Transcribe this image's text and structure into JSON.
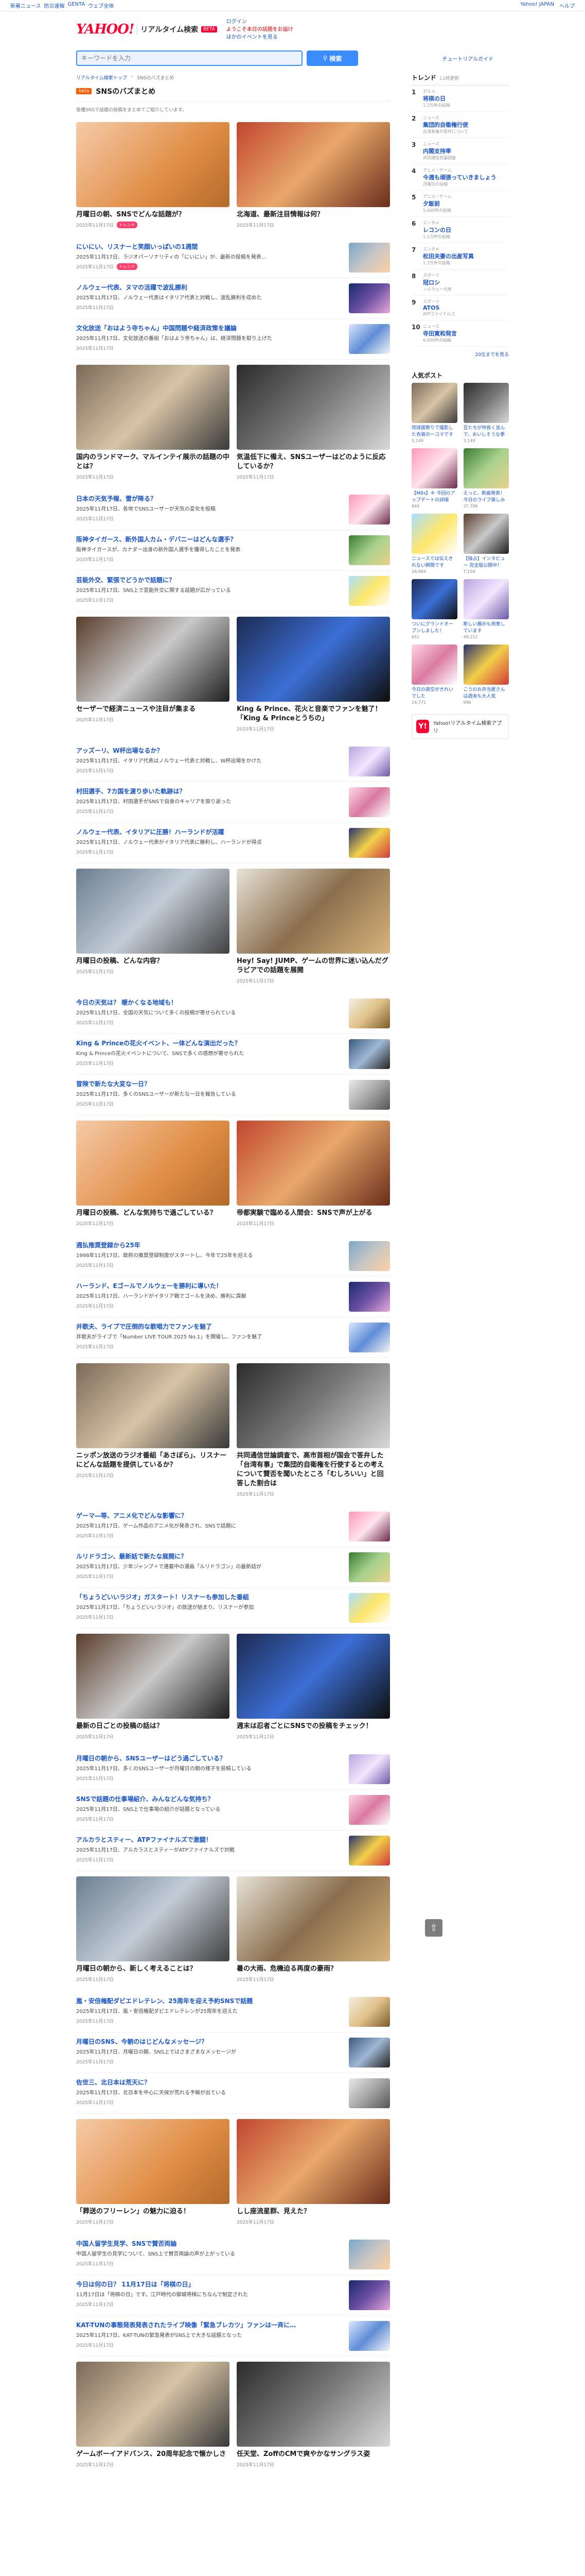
{
  "util": {
    "left": [
      "新着ニュース",
      "防災速報",
      "GENTA",
      "ウェブ全体"
    ],
    "right": [
      "Yahoo! JAPAN",
      "ヘルプ"
    ]
  },
  "header": {
    "logo": "YAHOO!",
    "logo_sub": "JAPAN",
    "service": "リアルタイム検索",
    "beta": "BETA",
    "links": [
      "ログイン",
      "ようこそ本日の話題をお届け",
      "ほかのイベントを見る"
    ]
  },
  "search": {
    "placeholder": "キーワードを入力",
    "button": "検索",
    "tutorial": "チュートリアルガイド"
  },
  "crumb": [
    "リアルタイム検索トップ",
    "SNSのバズまとめ"
  ],
  "page": {
    "badge": "beta",
    "title": "SNSのバズまとめ",
    "description": "各種SNSで話題の投稿をまとめてご紹介しています。"
  },
  "pairs": [
    [
      {
        "title": "月曜日の朝、SNSでどんな話題が？",
        "meta": "2025年11月17日",
        "tag": "トレンド"
      },
      {
        "title": "北海道、最新注目情報は何？",
        "meta": "2025年11月17日",
        "tag": ""
      }
    ],
    [
      {
        "title": "国内のランドマーク、マルインテイ展示の話題の中とは？",
        "meta": "2025年11月17日",
        "tag": ""
      },
      {
        "title": "気温低下に備え、SNSユーザーはどのように反応しているか？",
        "meta": "2025年11月17日",
        "tag": ""
      }
    ],
    [
      {
        "title": "セーザーで経済ニュースや注目が集まる",
        "meta": "2025年11月17日",
        "tag": ""
      },
      {
        "title": "King & Prince、花火と音楽でファンを魅了！「King & Princeとうちの」",
        "meta": "2025年11月17日",
        "tag": ""
      }
    ],
    [
      {
        "title": "月曜日の投稿、どんな内容？",
        "meta": "2025年11月17日",
        "tag": ""
      },
      {
        "title": "Hey! Say! JUMP、ゲームの世界に迷い込んだグラビアでの話題を展開",
        "meta": "2025年11月17日",
        "tag": ""
      }
    ],
    [
      {
        "title": "月曜日の投稿、どんな気持ちで過ごしている？",
        "meta": "2025年11月17日",
        "tag": ""
      },
      {
        "title": "帝都実験で臨める人間会：SNSで声が上がる",
        "meta": "2025年11月17日",
        "tag": ""
      }
    ],
    [
      {
        "title": "ニッポン放送のラジオ番組「あさぼら」、リスナーにどんな話題を提供しているか？",
        "meta": "2025年11月17日",
        "tag": ""
      },
      {
        "title": "共同通信世論調査で、高市首相が国会で答弁した「台湾有事」で集団的自衛権を行使するとの考えについて賛否を聞いたところ「むしろいい」と回答した割合は",
        "meta": "2025年11月17日",
        "tag": ""
      }
    ],
    [
      {
        "title": "最新の日ごとの投稿の話は？",
        "meta": "2025年11月17日",
        "tag": ""
      },
      {
        "title": "週末は忍者ごとにSNSでの投稿をチェック！",
        "meta": "2025年11月17日",
        "tag": ""
      }
    ],
    [
      {
        "title": "月曜日の朝から、新しく考えることは？",
        "meta": "2025年11月17日",
        "tag": ""
      },
      {
        "title": "暑の大雨、危機迫る再度の豪雨？",
        "meta": "2025年11月17日",
        "tag": ""
      }
    ],
    [
      {
        "title": "「葬送のフリーレン」の魅力に迫る！",
        "meta": "2025年11月17日",
        "tag": ""
      },
      {
        "title": "しし座流星群、見えた？",
        "meta": "2025年11月17日",
        "tag": ""
      }
    ],
    [
      {
        "title": "ゲームボーイアドバンス、20周年記念で懐かしさ",
        "meta": "2025年11月17日",
        "tag": ""
      },
      {
        "title": "任天堂、ZoffのCMで爽やかなサングラス姿",
        "meta": "2025年11月17日",
        "tag": ""
      }
    ]
  ],
  "lists": [
    [
      {
        "title": "にいにい、リスナーと笑顔いっぱいの1週間",
        "excerpt": "2025年11月17日、ラジオパーソナリティの「にいにい」が、最新の投稿を発表...",
        "meta": "2025年11月17日",
        "tag": "トレンド"
      },
      {
        "title": "ノルウェー代表、ヌマの活躍で波乱勝利",
        "excerpt": "2025年11月17日、ノルウェー代表はイタリア代表と対戦し、波乱勝利を収めた",
        "meta": "2025年11月17日",
        "tag": ""
      },
      {
        "title": "文化放送「おはよう寺ちゃん」中国問題や経済政策を議論",
        "excerpt": "2025年11月17日、文化放送の番組「おはよう寺ちゃん」は、経済問題を取り上げた",
        "meta": "2025年11月17日",
        "tag": ""
      }
    ],
    [
      {
        "title": "日本の天気予報、雪が降る？",
        "excerpt": "2025年11月17日、各地でSNSユーザーが天気の変化を投稿",
        "meta": "2025年11月17日",
        "tag": ""
      },
      {
        "title": "阪神タイガース、新外国人カム・デバニーはどんな選手？",
        "excerpt": "阪神タイガースが、カナダー出身の新外国人選手を獲得したことを発表",
        "meta": "2025年11月17日",
        "tag": ""
      },
      {
        "title": "芸能外交、緊張でどうかで話題に？",
        "excerpt": "2025年11月17日、SNS上で芸能外交に関する話題が広がっている",
        "meta": "2025年11月17日",
        "tag": ""
      }
    ],
    [
      {
        "title": "アッズーリ、W杯出場なるか？",
        "excerpt": "2025年11月17日、イタリア代表はノルウェー代表と対戦し、W杯出場をかけた",
        "meta": "2025年11月17日",
        "tag": ""
      },
      {
        "title": "村田選手、7カ国を渡り歩いた軌跡は？",
        "excerpt": "2025年11月17日、村田選手がSNSで自身のキャリアを振り返った",
        "meta": "2025年11月17日",
        "tag": ""
      },
      {
        "title": "ノルウェー代表、イタリアに圧勝！ハーランドが活躍",
        "excerpt": "2025年11月17日、ノルウェー代表がイタリア代表に勝利し、ハーランドが得点",
        "meta": "2025年11月17日",
        "tag": ""
      }
    ],
    [
      {
        "title": "今日の天気は？ 暖かくなる地域も！",
        "excerpt": "2025年11月17日、全国の天気について多くの投稿が寄せられている",
        "meta": "2025年11月17日",
        "tag": ""
      },
      {
        "title": "King & Princeの花火イベント、一体どんな演出だった？",
        "excerpt": "King & Princeの花火イベントについて、SNSで多くの感想が寄せられた",
        "meta": "2025年11月17日",
        "tag": ""
      },
      {
        "title": "冒険で新たな大変な一日？",
        "excerpt": "2025年11月17日、多くのSNSユーザーが新たな一日を報告している",
        "meta": "2025年11月17日",
        "tag": ""
      }
    ],
    [
      {
        "title": "週払推奨登録から25年",
        "excerpt": "1998年11月17日、政府の推奨登録制度がスタートし、今年で25年を迎える",
        "meta": "2025年11月17日",
        "tag": ""
      },
      {
        "title": "ハーランド、Eゴールでノルウェーを勝利に導いた！",
        "excerpt": "2025年11月17日、ハーランドがイタリア戦でゴールを決め、勝利に貢献",
        "meta": "2025年11月17日",
        "tag": ""
      },
      {
        "title": "井歌夫、ライブで圧倒的な歌唱力でファンを魅了",
        "excerpt": "井歌夫がライブで「Number LIVE TOUR 2025 No.1」を開催し、ファンを魅了",
        "meta": "2025年11月17日",
        "tag": ""
      }
    ],
    [
      {
        "title": "ゲーマ―等、アニメ化でどんな影響に？",
        "excerpt": "2025年11月17日、ゲーム作品のアニメ化が発表され、SNSで話題に",
        "meta": "2025年11月17日",
        "tag": ""
      },
      {
        "title": "ルリドラゴン、最新話で新たな展開に？",
        "excerpt": "2025年11月17日、少年ジャンプ＋で連載中の漫画「ルリドラゴン」の最新話が",
        "meta": "2025年11月17日",
        "tag": ""
      },
      {
        "title": "「ちょうどいいラジオ」ガスタート！リスナーも参加した番組",
        "excerpt": "2025年11月17日、「ちょうどいいラジオ」の放送が始まり、リスナーが参加",
        "meta": "2025年11月17日",
        "tag": ""
      }
    ],
    [
      {
        "title": "月曜日の朝から、SNSユーザーはどう過ごしている？",
        "excerpt": "2025年11月17日、多くのSNSユーザーが月曜日の朝の様子を投稿している",
        "meta": "2025年11月17日",
        "tag": ""
      },
      {
        "title": "SNSで話題の仕事場紹介、みんなどんな気持ち？",
        "excerpt": "2025年11月17日、SNS上で仕事場の紹介が話題となっている",
        "meta": "2025年11月17日",
        "tag": ""
      },
      {
        "title": "アルカラとスティー、ATPファイナルズで激闘！",
        "excerpt": "2025年11月17日、アルカラスとスティーがATPファイナルズで対戦",
        "meta": "2025年11月17日",
        "tag": ""
      }
    ],
    [
      {
        "title": "嵐・安倍権配ダビエドレテレン、25周年を迎え予約SNSで話題",
        "excerpt": "2025年11月17日、嵐・安倍権配ダビエドレテレンが25周年を迎えた",
        "meta": "2025年11月17日",
        "tag": ""
      },
      {
        "title": "月曜日のSNS、今朝のはじどんなメッセージ？",
        "excerpt": "2025年11月17日、月曜日の朝、SNS上ではさまざまなメッセージが",
        "meta": "2025年11月17日",
        "tag": ""
      },
      {
        "title": "佐世三、北日本は荒天に？",
        "excerpt": "2025年11月17日、北日本を中心に天候が荒れる予報が出ている",
        "meta": "2025年11月17日",
        "tag": ""
      }
    ],
    [
      {
        "title": "中国人留学生見学、SNSで賛否両論",
        "excerpt": "中国人留学生の見学について、SNS上で賛否両論の声が上がっている",
        "meta": "2025年11月17日",
        "tag": ""
      },
      {
        "title": "今日は何の日？ 11月17日は「将棋の日」",
        "excerpt": "11月17日は「将棋の日」です。江戸時代の御城将棋にちなんで制定された",
        "meta": "2025年11月17日",
        "tag": ""
      },
      {
        "title": "KAT-TUNの事態発表発表されたライブ映像「緊急ブレカツ」ファンは一斉に…",
        "excerpt": "2025年11月17日、KAT-TUNの緊急発表がSNS上で大きな話題となった",
        "meta": "2025年11月17日",
        "tag": ""
      }
    ]
  ],
  "sidebar": {
    "trend_title": "トレンド",
    "trend_updated": "11時更新",
    "trends": [
      {
        "rank": "1",
        "category": "グルメ",
        "keyword": "将棋の日",
        "sub": "1.2万件の投稿"
      },
      {
        "rank": "2",
        "category": "ニュース",
        "keyword": "集団的自衛権行使",
        "sub": "台湾有事の答弁について"
      },
      {
        "rank": "3",
        "category": "ニュース",
        "keyword": "内閣支持率",
        "sub": "共同通信世論調査"
      },
      {
        "rank": "4",
        "category": "アニメ・ゲーム",
        "keyword": "今週も頑張っていきましょう",
        "sub": "月曜日の投稿"
      },
      {
        "rank": "5",
        "category": "アニメ・ゲーム",
        "keyword": "夕飯前",
        "sub": "5,000件の投稿"
      },
      {
        "rank": "6",
        "category": "エンタメ",
        "keyword": "レコンの日",
        "sub": "1.1万件の投稿"
      },
      {
        "rank": "7",
        "category": "エンタメ",
        "keyword": "松田夫妻の出産写真",
        "sub": "1.7万件の投稿"
      },
      {
        "rank": "8",
        "category": "スポーツ",
        "keyword": "冠ロシ",
        "sub": "ノルウェー代表"
      },
      {
        "rank": "9",
        "category": "スポーツ",
        "keyword": "ATOS",
        "sub": "ATPファイナルズ"
      },
      {
        "rank": "10",
        "category": "ニュース",
        "keyword": "寺田寛和発言",
        "sub": "6,000件の投稿"
      }
    ],
    "trend_more": "20位までを見る",
    "photo_title": "人気ポスト",
    "photos": [
      {
        "caption": "琉球国祭りで撮影した衣装の一コマです",
        "count": "5,149"
      },
      {
        "caption": "豆たちが仲良く並んで、おいしそうな季節",
        "count": "3,148"
      },
      {
        "caption": "【MBs】キ 今回のアップデートの詳細",
        "count": "844"
      },
      {
        "caption": "えっと、新曲発表！ 今日のライブ楽しみ",
        "count": "37,706"
      },
      {
        "caption": "ニュースでは伝えきれない瞬間です",
        "count": "26,984"
      },
      {
        "caption": "【独占】インタビュー 完全版公開中！",
        "count": "7,158"
      },
      {
        "caption": "ついにグランドオープンしました！",
        "count": "651"
      },
      {
        "caption": "新しい展示も用意しています",
        "count": "49,211"
      },
      {
        "caption": "今日の夜空がきれいでした",
        "count": "24,771"
      },
      {
        "caption": "こうのお弁当屋さんは週末も大人気",
        "count": "996"
      }
    ],
    "app_label": "Yahoo!リアルタイム検索アプリ",
    "app_icon": "Y!"
  }
}
